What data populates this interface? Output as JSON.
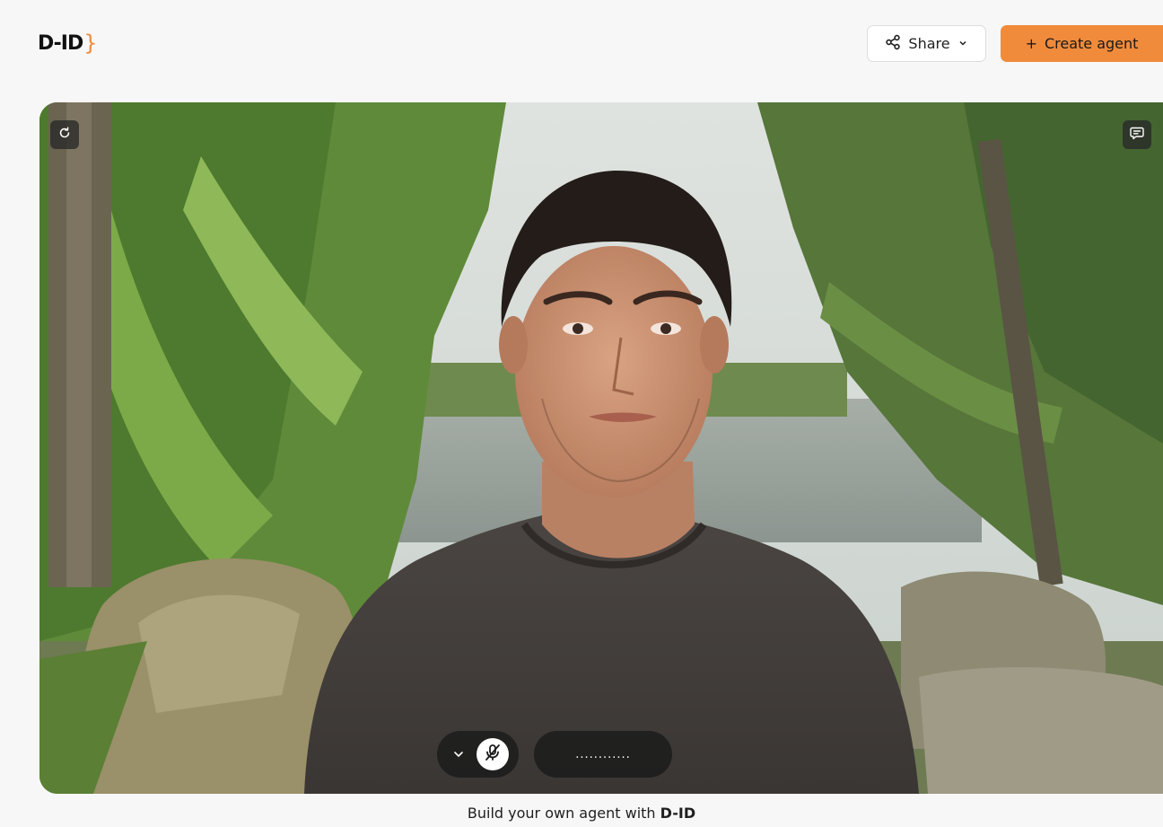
{
  "header": {
    "logo_text": "D-ID",
    "logo_brace": "}",
    "share_label": "Share",
    "create_label": "Create agent",
    "create_prefix": "+"
  },
  "video": {
    "refresh_icon": "refresh-icon",
    "chat_icon": "chat-icon",
    "status_text": "............"
  },
  "controls": {
    "chevron_icon": "chevron-down-icon",
    "mic_icon": "mic-off-icon"
  },
  "footer": {
    "text": "Build your own agent with ",
    "brand": "D-ID"
  },
  "colors": {
    "accent": "#f08b3c",
    "background": "#f7f7f7",
    "pill": "#1c1c1c"
  }
}
